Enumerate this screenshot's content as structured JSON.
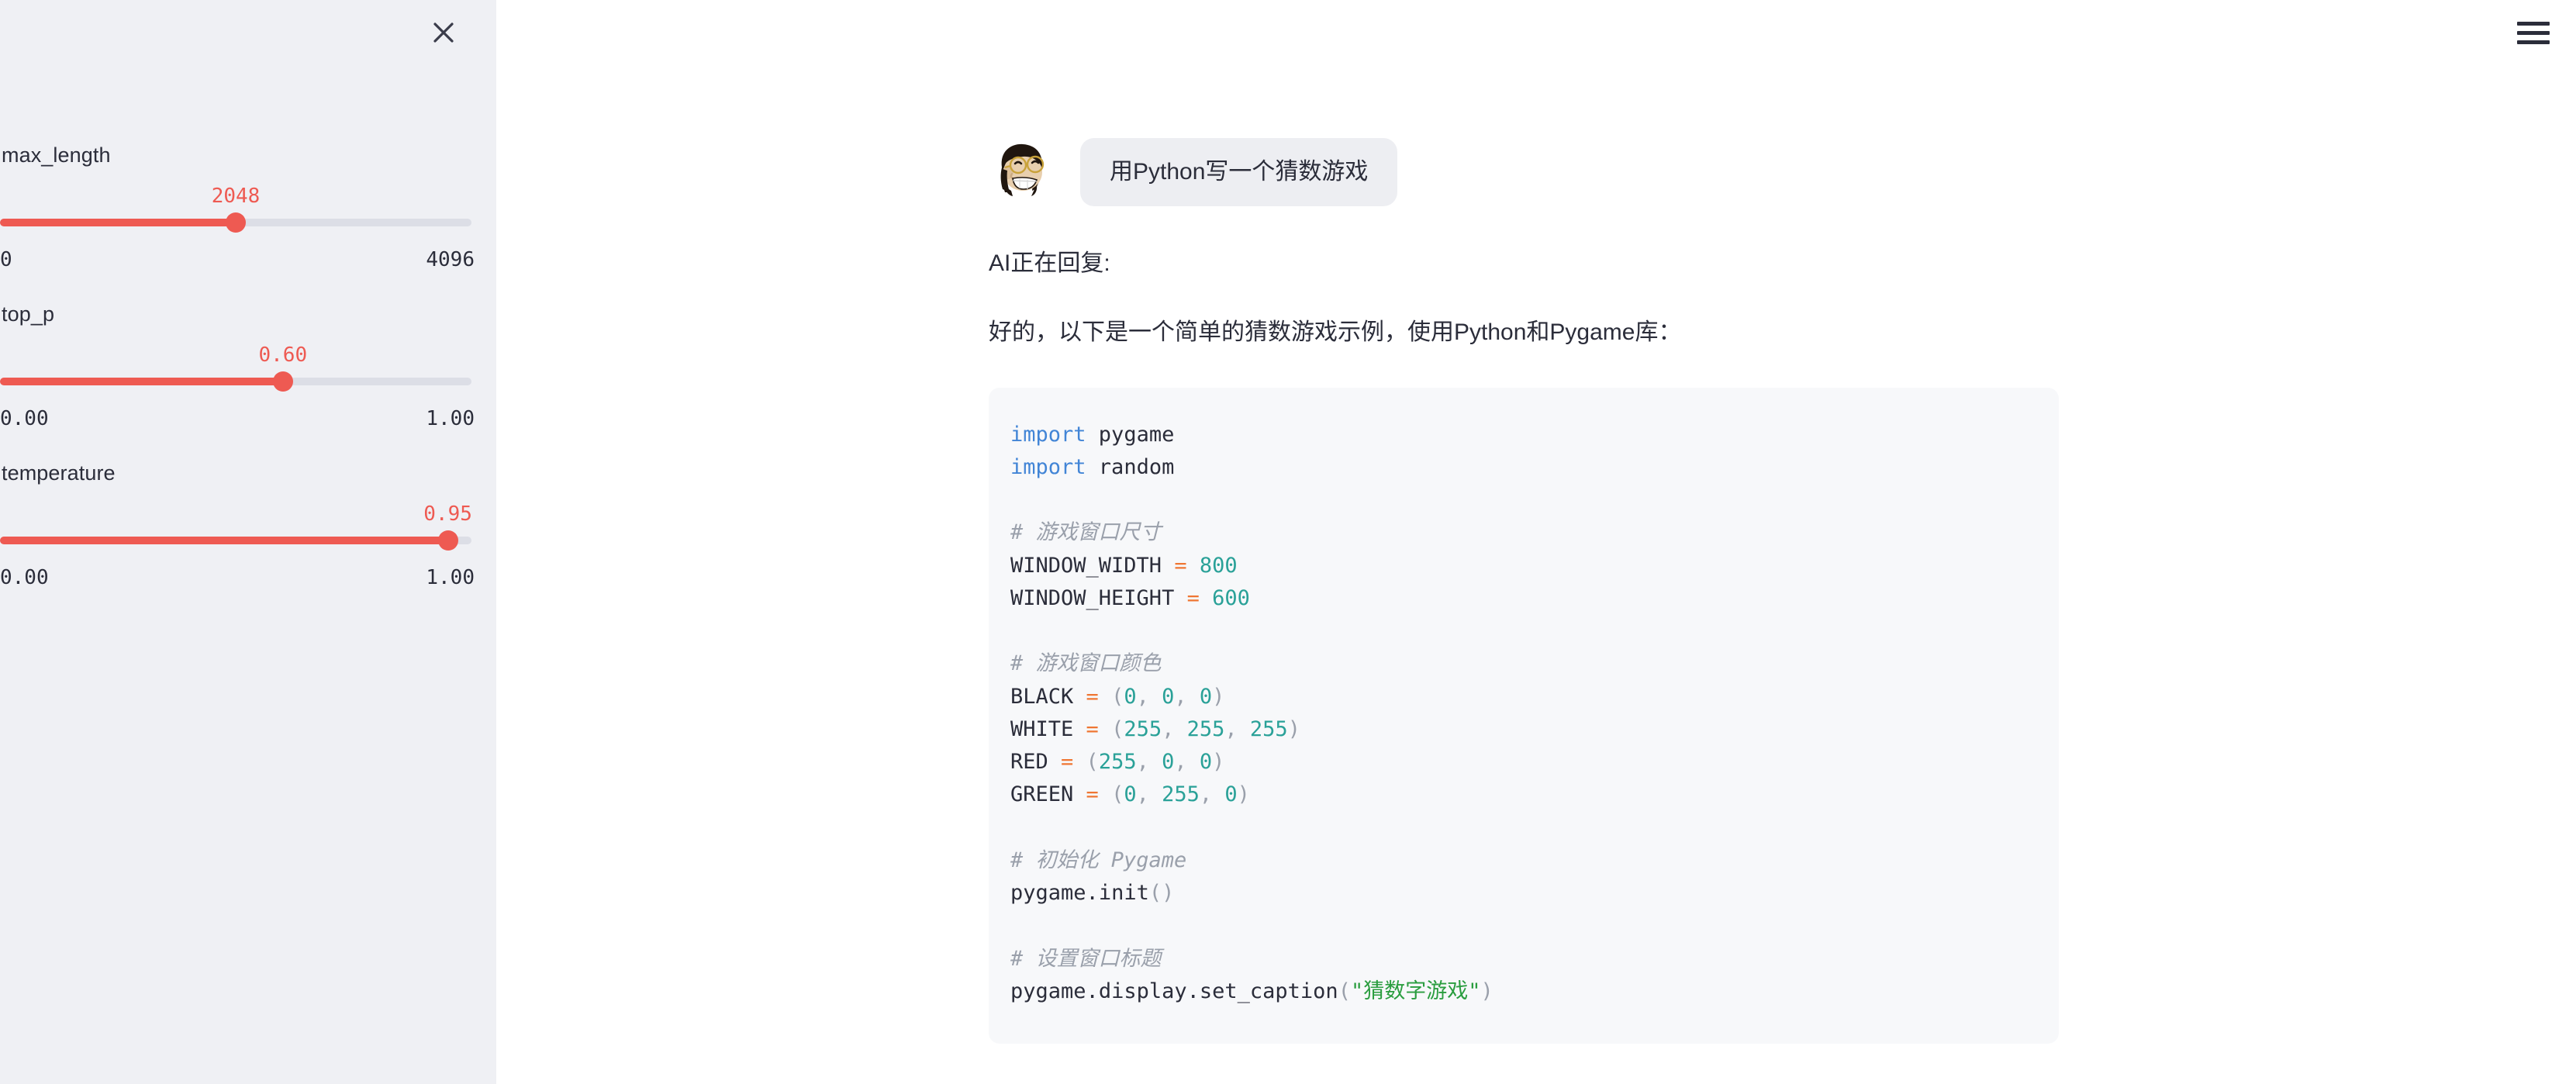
{
  "sidebar": {
    "close_icon": "close-icon",
    "sliders": [
      {
        "name": "max_length",
        "value": "2048",
        "min": "0",
        "max": "4096",
        "percent": 50
      },
      {
        "name": "top_p",
        "value": "0.60",
        "min": "0.00",
        "max": "1.00",
        "percent": 60
      },
      {
        "name": "temperature",
        "value": "0.95",
        "min": "0.00",
        "max": "1.00",
        "percent": 95
      }
    ]
  },
  "header": {
    "menu_icon": "hamburger-menu-icon"
  },
  "conversation": {
    "avatar_icon": "user-avatar-icon",
    "user_message": "用Python写一个猜数游戏",
    "ai_status": "AI正在回复:",
    "ai_intro": "好的，以下是一个简单的猜数游戏示例，使用Python和Pygame库："
  },
  "code_block": {
    "language": "python",
    "lines": [
      [
        {
          "t": "import",
          "c": "kw"
        },
        {
          "t": " pygame",
          "c": "plain"
        }
      ],
      [
        {
          "t": "import",
          "c": "kw"
        },
        {
          "t": " random",
          "c": "plain"
        }
      ],
      [],
      [
        {
          "t": "# 游戏窗口尺寸",
          "c": "comment"
        }
      ],
      [
        {
          "t": "WINDOW_WIDTH ",
          "c": "plain"
        },
        {
          "t": "=",
          "c": "op"
        },
        {
          "t": " ",
          "c": "plain"
        },
        {
          "t": "800",
          "c": "num"
        }
      ],
      [
        {
          "t": "WINDOW_HEIGHT ",
          "c": "plain"
        },
        {
          "t": "=",
          "c": "op"
        },
        {
          "t": " ",
          "c": "plain"
        },
        {
          "t": "600",
          "c": "num"
        }
      ],
      [],
      [
        {
          "t": "# 游戏窗口颜色",
          "c": "comment"
        }
      ],
      [
        {
          "t": "BLACK ",
          "c": "plain"
        },
        {
          "t": "=",
          "c": "op"
        },
        {
          "t": " (",
          "c": "punc"
        },
        {
          "t": "0",
          "c": "num"
        },
        {
          "t": ", ",
          "c": "punc"
        },
        {
          "t": "0",
          "c": "num"
        },
        {
          "t": ", ",
          "c": "punc"
        },
        {
          "t": "0",
          "c": "num"
        },
        {
          "t": ")",
          "c": "punc"
        }
      ],
      [
        {
          "t": "WHITE ",
          "c": "plain"
        },
        {
          "t": "=",
          "c": "op"
        },
        {
          "t": " (",
          "c": "punc"
        },
        {
          "t": "255",
          "c": "num"
        },
        {
          "t": ", ",
          "c": "punc"
        },
        {
          "t": "255",
          "c": "num"
        },
        {
          "t": ", ",
          "c": "punc"
        },
        {
          "t": "255",
          "c": "num"
        },
        {
          "t": ")",
          "c": "punc"
        }
      ],
      [
        {
          "t": "RED ",
          "c": "plain"
        },
        {
          "t": "=",
          "c": "op"
        },
        {
          "t": " (",
          "c": "punc"
        },
        {
          "t": "255",
          "c": "num"
        },
        {
          "t": ", ",
          "c": "punc"
        },
        {
          "t": "0",
          "c": "num"
        },
        {
          "t": ", ",
          "c": "punc"
        },
        {
          "t": "0",
          "c": "num"
        },
        {
          "t": ")",
          "c": "punc"
        }
      ],
      [
        {
          "t": "GREEN ",
          "c": "plain"
        },
        {
          "t": "=",
          "c": "op"
        },
        {
          "t": " (",
          "c": "punc"
        },
        {
          "t": "0",
          "c": "num"
        },
        {
          "t": ", ",
          "c": "punc"
        },
        {
          "t": "255",
          "c": "num"
        },
        {
          "t": ", ",
          "c": "punc"
        },
        {
          "t": "0",
          "c": "num"
        },
        {
          "t": ")",
          "c": "punc"
        }
      ],
      [],
      [
        {
          "t": "# 初始化 Pygame",
          "c": "comment"
        }
      ],
      [
        {
          "t": "pygame",
          "c": "plain"
        },
        {
          "t": ".",
          "c": "plain"
        },
        {
          "t": "init",
          "c": "plain"
        },
        {
          "t": "()",
          "c": "punc"
        }
      ],
      [],
      [
        {
          "t": "# 设置窗口标题",
          "c": "comment"
        }
      ],
      [
        {
          "t": "pygame",
          "c": "plain"
        },
        {
          "t": ".",
          "c": "plain"
        },
        {
          "t": "display",
          "c": "plain"
        },
        {
          "t": ".",
          "c": "plain"
        },
        {
          "t": "set_caption",
          "c": "plain"
        },
        {
          "t": "(",
          "c": "punc"
        },
        {
          "t": "\"猜数字游戏\"",
          "c": "str"
        },
        {
          "t": ")",
          "c": "punc"
        }
      ]
    ]
  },
  "colors": {
    "accent": "#ee5a52",
    "sidebar_bg": "#eff0f4",
    "code_bg": "#f7f8fa",
    "text": "#2b2d3a",
    "track": "#dcdee6",
    "bubble_bg": "#edeef2"
  }
}
